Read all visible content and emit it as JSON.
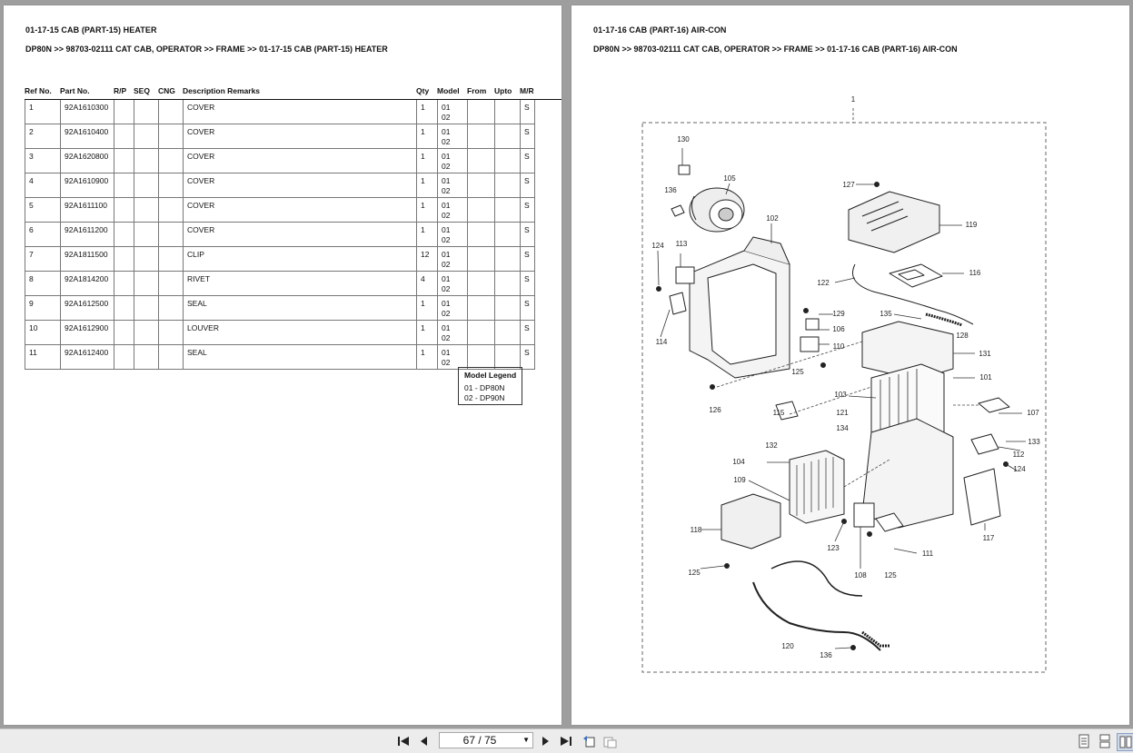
{
  "left_page": {
    "title": "01-17-15 CAB (PART-15) HEATER",
    "breadcrumb": "DP80N >> 98703-02111 CAT CAB, OPERATOR >> FRAME >> 01-17-15 CAB (PART-15) HEATER",
    "columns": [
      "Ref No.",
      "Part No.",
      "R/P",
      "SEQ",
      "CNG",
      "Description Remarks",
      "Qty",
      "Model",
      "From",
      "Upto",
      "M/R"
    ],
    "rows": [
      {
        "ref": "1",
        "part": "92A1610300",
        "desc": "COVER",
        "qty": "1",
        "m1": "01",
        "m2": "02",
        "mr": "S"
      },
      {
        "ref": "2",
        "part": "92A1610400",
        "desc": "COVER",
        "qty": "1",
        "m1": "01",
        "m2": "02",
        "mr": "S"
      },
      {
        "ref": "3",
        "part": "92A1620800",
        "desc": "COVER",
        "qty": "1",
        "m1": "01",
        "m2": "02",
        "mr": "S"
      },
      {
        "ref": "4",
        "part": "92A1610900",
        "desc": "COVER",
        "qty": "1",
        "m1": "01",
        "m2": "02",
        "mr": "S"
      },
      {
        "ref": "5",
        "part": "92A1611100",
        "desc": "COVER",
        "qty": "1",
        "m1": "01",
        "m2": "02",
        "mr": "S"
      },
      {
        "ref": "6",
        "part": "92A1611200",
        "desc": "COVER",
        "qty": "1",
        "m1": "01",
        "m2": "02",
        "mr": "S"
      },
      {
        "ref": "7",
        "part": "92A1811500",
        "desc": "CLIP",
        "qty": "12",
        "m1": "01",
        "m2": "02",
        "mr": "S"
      },
      {
        "ref": "8",
        "part": "92A1814200",
        "desc": "RIVET",
        "qty": "4",
        "m1": "01",
        "m2": "02",
        "mr": "S"
      },
      {
        "ref": "9",
        "part": "92A1612500",
        "desc": "SEAL",
        "qty": "1",
        "m1": "01",
        "m2": "02",
        "mr": "S"
      },
      {
        "ref": "10",
        "part": "92A1612900",
        "desc": "LOUVER",
        "qty": "1",
        "m1": "01",
        "m2": "02",
        "mr": "S"
      },
      {
        "ref": "11",
        "part": "92A1612400",
        "desc": "SEAL",
        "qty": "1",
        "m1": "01",
        "m2": "02",
        "mr": "S"
      }
    ],
    "legend": {
      "title": "Model Legend",
      "items": [
        "01 - DP80N",
        "02 - DP90N"
      ]
    }
  },
  "right_page": {
    "title": "01-17-16 CAB (PART-16) AIR-CON",
    "breadcrumb": "DP80N >> 98703-02111 CAT CAB, OPERATOR >> FRAME >> 01-17-16 CAB (PART-16) AIR-CON",
    "callouts": [
      "1",
      "130",
      "105",
      "136",
      "102",
      "124",
      "113",
      "114",
      "127",
      "119",
      "116",
      "122",
      "135",
      "128",
      "129",
      "106",
      "110",
      "125",
      "131",
      "101",
      "103",
      "107",
      "121",
      "134",
      "115",
      "126",
      "132",
      "133",
      "112",
      "124",
      "104",
      "109",
      "118",
      "123",
      "108",
      "125",
      "111",
      "117",
      "125",
      "120",
      "136"
    ]
  },
  "toolbar": {
    "page_indicator": "67 / 75",
    "icons": [
      "first-page-icon",
      "prev-page-icon",
      "next-page-icon",
      "last-page-icon",
      "back-view-icon",
      "forward-view-icon",
      "single-page-icon",
      "continuous-page-icon",
      "facing-pages-icon"
    ]
  },
  "colors": {
    "viewer_bg": "#9e9e9e",
    "page_bg": "#ffffff",
    "toolbar_bg": "#ececec"
  }
}
